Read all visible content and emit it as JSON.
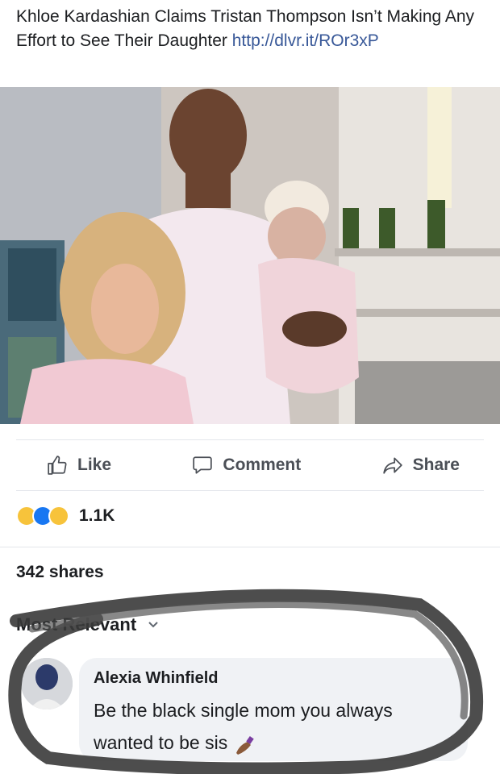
{
  "post": {
    "text": "Khloe Kardashian Claims Tristan Thompson Isn’t Making Any Effort to See Their Daughter ",
    "link": "http://dlvr.it/ROr3xP"
  },
  "actions": {
    "like_label": "Like",
    "comment_label": "Comment",
    "share_label": "Share"
  },
  "reactions": {
    "types": [
      "haha",
      "like",
      "wow"
    ],
    "count": "1.1K"
  },
  "shares": "342 shares",
  "comments_filter": "Most Relevant",
  "comment": {
    "author": "Alexia Whinfield",
    "text": "Be the black single mom you always wanted to be sis",
    "emoji": "nail-polish-emoji"
  },
  "colors": {
    "link": "#385898",
    "like_blue": "#1877f2",
    "reaction_yellow": "#f7c33b",
    "bubble_bg": "#f0f2f5",
    "scribble": "#3a3a3a"
  }
}
